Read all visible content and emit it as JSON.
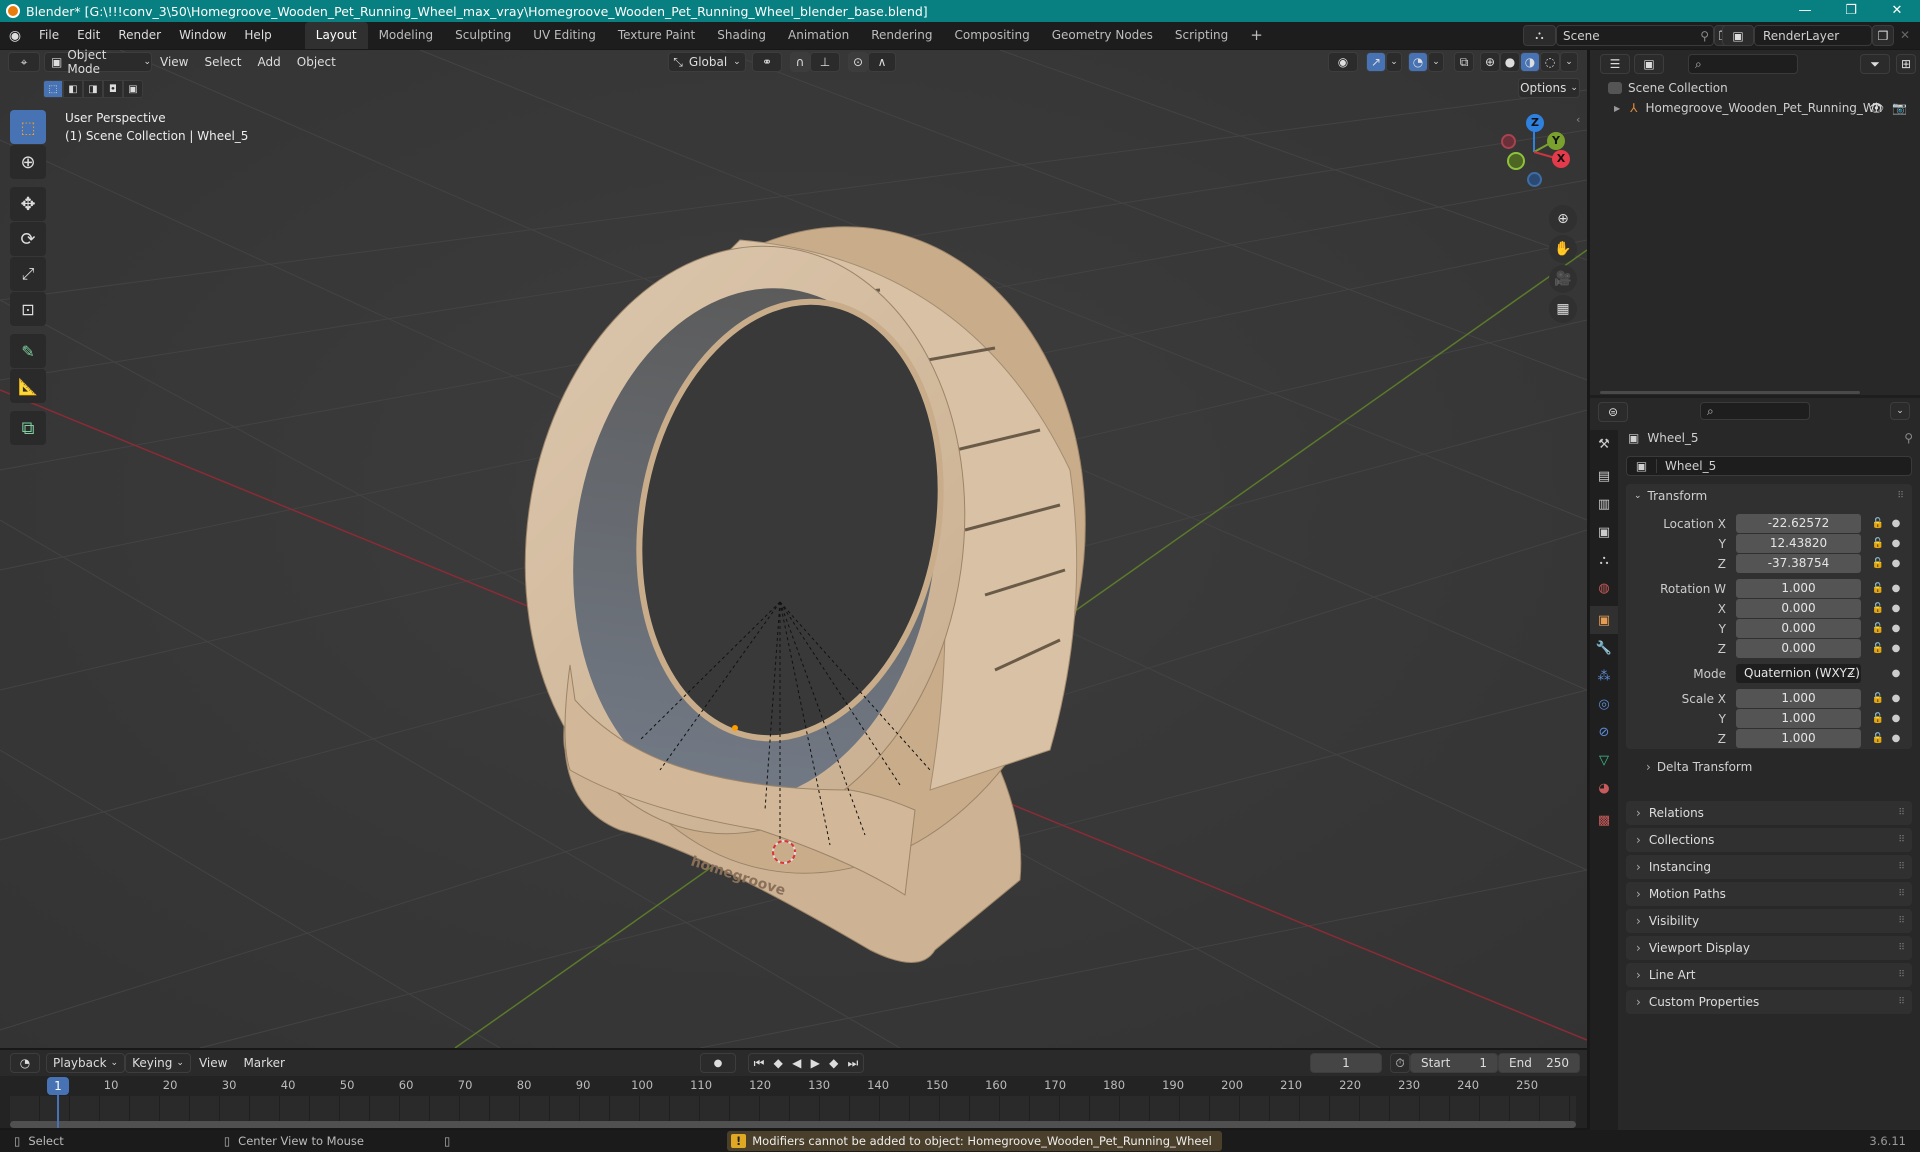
{
  "window": {
    "title": "Blender* [G:\\!!!conv_3\\50\\Homegroove_Wooden_Pet_Running_Wheel_max_vray\\Homegroove_Wooden_Pet_Running_Wheel_blender_base.blend]",
    "minimize": "—",
    "maximize": "❐",
    "close": "✕"
  },
  "menubar": {
    "menus": [
      "File",
      "Edit",
      "Render",
      "Window",
      "Help"
    ],
    "workspaces": [
      "Layout",
      "Modeling",
      "Sculpting",
      "UV Editing",
      "Texture Paint",
      "Shading",
      "Animation",
      "Rendering",
      "Compositing",
      "Geometry Nodes",
      "Scripting"
    ],
    "active_workspace": "Layout",
    "add_workspace": "+",
    "scene_label": "Scene",
    "render_layer_label": "RenderLayer"
  },
  "viewport": {
    "mode": "Object Mode",
    "menus": [
      "View",
      "Select",
      "Add",
      "Object"
    ],
    "orientation": "Global",
    "options_label": "Options",
    "overlay_line1": "User Perspective",
    "overlay_line2": "(1) Scene Collection | Wheel_5",
    "gizmo_axes": {
      "x": "X",
      "y": "Y",
      "z": "Z"
    },
    "brand_text": "homegroove",
    "colors": {
      "x_axis": "#c9363f",
      "y_axis": "#7aa12e",
      "z_axis": "#2f81e0",
      "wood": "#d6bfa3",
      "felt": "#6b7078",
      "grid_bg": "#393939"
    }
  },
  "toolbar": {
    "tools": [
      "select-box",
      "cursor",
      "move",
      "rotate",
      "scale",
      "transform",
      "annotate",
      "measure",
      "add-cube"
    ],
    "active_tool": "select-box"
  },
  "outliner": {
    "search_placeholder": "",
    "root": "Scene Collection",
    "items": [
      {
        "name": "Homegroove_Wooden_Pet_Running_Wh",
        "type": "empty"
      }
    ]
  },
  "properties": {
    "object_name_header": "Wheel_5",
    "object_name_field": "Wheel_5",
    "transform": {
      "title": "Transform",
      "location": {
        "label": "Location X",
        "x": "-22.62572",
        "y": "12.43820",
        "z": "-37.38754"
      },
      "rotation": {
        "label": "Rotation W",
        "w": "1.000",
        "x": "0.000",
        "y": "0.000",
        "z": "0.000"
      },
      "mode_label": "Mode",
      "mode_value": "Quaternion (WXYZ)",
      "scale": {
        "label": "Scale X",
        "x": "1.000",
        "y": "1.000",
        "z": "1.000"
      },
      "axis_labels": {
        "y": "Y",
        "z": "Z",
        "x": "X"
      },
      "delta": "Delta Transform"
    },
    "panels": [
      "Relations",
      "Collections",
      "Instancing",
      "Motion Paths",
      "Visibility",
      "Viewport Display",
      "Line Art",
      "Custom Properties"
    ]
  },
  "timeline": {
    "menus": [
      "Playback",
      "Keying",
      "View",
      "Marker"
    ],
    "current_frame": "1",
    "start_label": "Start",
    "start": "1",
    "end_label": "End",
    "end": "250",
    "ticks": [
      "10",
      "20",
      "30",
      "40",
      "50",
      "60",
      "70",
      "80",
      "90",
      "100",
      "110",
      "120",
      "130",
      "140",
      "150",
      "160",
      "170",
      "180",
      "190",
      "200",
      "210",
      "220",
      "230",
      "240",
      "250"
    ],
    "playhead": "1"
  },
  "statusbar": {
    "select": "Select",
    "center_view": "Center View to Mouse",
    "warning": "Modifiers cannot be added to object: Homegroove_Wooden_Pet_Running_Wheel",
    "version": "3.6.11"
  }
}
